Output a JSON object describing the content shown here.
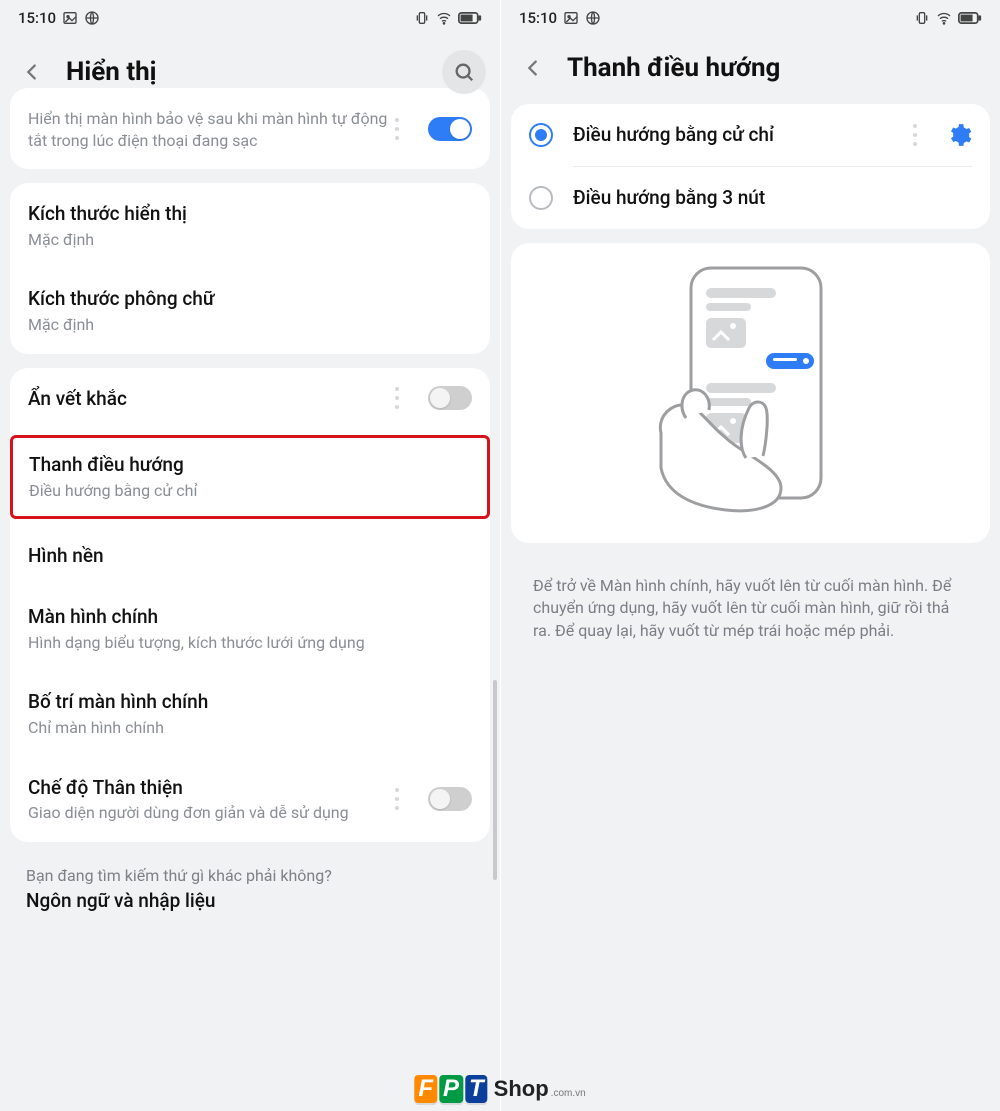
{
  "status": {
    "time": "15:10",
    "image_icon": "image-icon",
    "browser_icon": "globe-icon",
    "vibrate_icon": "vibrate-icon",
    "wifi_icon": "wifi-icon",
    "battery_icon": "battery-icon"
  },
  "left": {
    "title": "Hiển thị",
    "screensaver_sub": "Hiển thị màn hình bảo vệ sau khi màn hình tự động tắt trong lúc điện thoại đang sạc",
    "screensaver_on": true,
    "display_size_title": "Kích thước hiển thị",
    "display_size_sub": "Mặc định",
    "font_size_title": "Kích thước phông chữ",
    "font_size_sub": "Mặc định",
    "hide_notch_title": "Ẩn vết khắc",
    "hide_notch_on": false,
    "nav_bar_title": "Thanh điều hướng",
    "nav_bar_sub": "Điều hướng bằng cử chỉ",
    "wallpaper_title": "Hình nền",
    "home_title": "Màn hình chính",
    "home_sub": "Hình dạng biểu tượng, kích thước lưới ứng dụng",
    "home_layout_title": "Bố trí màn hình chính",
    "home_layout_sub": "Chỉ màn hình chính",
    "friendly_title": "Chế độ Thân thiện",
    "friendly_sub": "Giao diện người dùng đơn giản và dễ sử dụng",
    "friendly_on": false,
    "footer_hint": "Bạn đang tìm kiếm thứ gì khác phải không?",
    "footer_title": "Ngôn ngữ và nhập liệu"
  },
  "right": {
    "title": "Thanh điều hướng",
    "opt_gesture": "Điều hướng bằng cử chỉ",
    "opt_buttons": "Điều hướng bằng 3 nút",
    "selected": "gesture",
    "help": "Để trở về Màn hình chính, hãy vuốt lên từ cuối màn hình. Để chuyển ứng dụng, hãy vuốt lên từ cuối màn hình, giữ rồi thả ra. Để quay lại, hãy vuốt từ mép trái hoặc mép phải."
  },
  "logo": {
    "f": "F",
    "p": "P",
    "t": "T",
    "shop": "Shop",
    "tld": ".com.vn"
  }
}
